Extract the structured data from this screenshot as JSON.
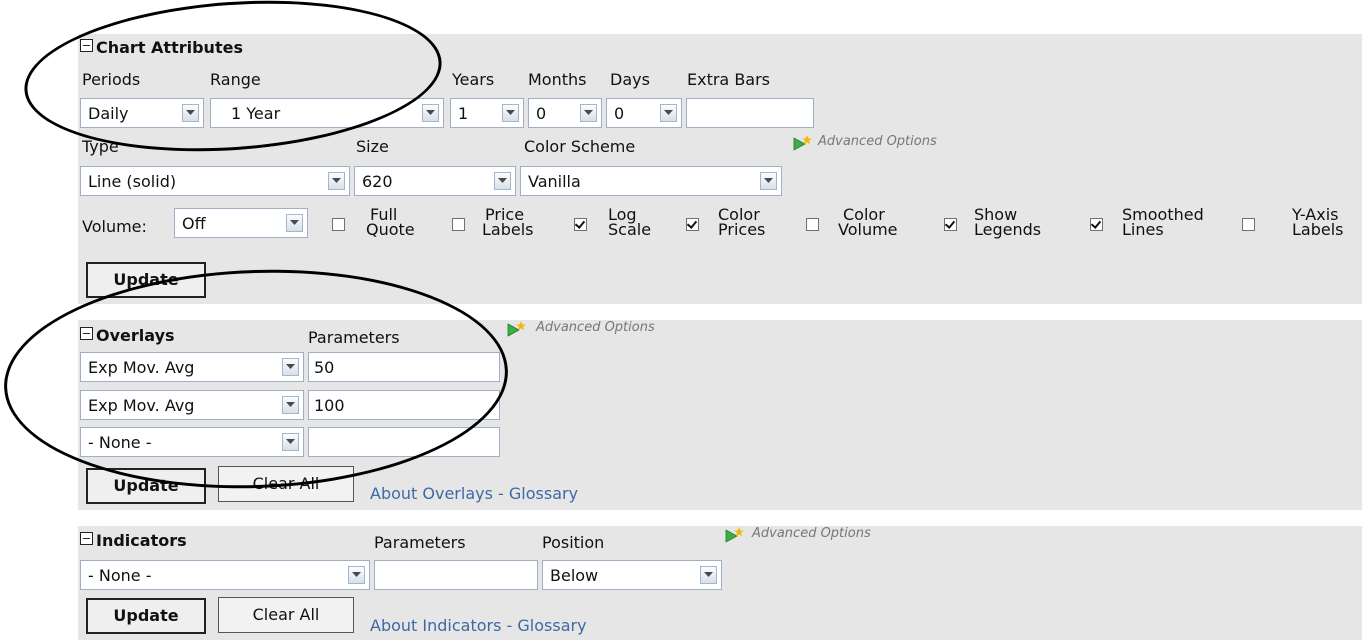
{
  "chart_attributes": {
    "title": "Chart Attributes",
    "periods_label": "Periods",
    "range_label": "Range",
    "years_label": "Years",
    "months_label": "Months",
    "days_label": "Days",
    "extra_bars_label": "Extra Bars",
    "periods_value": "Daily",
    "range_value": "1 Year",
    "years_value": "1",
    "months_value": "0",
    "days_value": "0",
    "extra_bars_value": "",
    "type_label": "Type",
    "size_label": "Size",
    "color_scheme_label": "Color Scheme",
    "advanced_options": "Advanced Options",
    "type_value": "Line (solid)",
    "size_value": "620",
    "color_scheme_value": "Vanilla",
    "volume_label": "Volume:",
    "volume_value": "Off",
    "checkboxes": [
      {
        "line1": "Full",
        "line2": "Quote",
        "checked": false
      },
      {
        "line1": "Price",
        "line2": "Labels",
        "checked": false
      },
      {
        "line1": "Log",
        "line2": "Scale",
        "checked": true
      },
      {
        "line1": "Color",
        "line2": "Prices",
        "checked": true
      },
      {
        "line1": "Color",
        "line2": "Volume",
        "checked": false
      },
      {
        "line1": "Show",
        "line2": "Legends",
        "checked": true
      },
      {
        "line1": "Smoothed",
        "line2": "Lines",
        "checked": true
      },
      {
        "line1": "Y-Axis",
        "line2": "Labels",
        "checked": false
      }
    ],
    "update_label": "Update"
  },
  "overlays": {
    "title": "Overlays",
    "parameters_label": "Parameters",
    "advanced_options": "Advanced Options",
    "rows": [
      {
        "type": "Exp Mov. Avg",
        "param": "50"
      },
      {
        "type": "Exp Mov. Avg",
        "param": "100"
      },
      {
        "type": "- None -",
        "param": ""
      }
    ],
    "update_label": "Update",
    "clear_all_label": "Clear All",
    "about_link": "About Overlays",
    "separator": " - ",
    "glossary_link": "Glossary"
  },
  "indicators": {
    "title": "Indicators",
    "parameters_label": "Parameters",
    "position_label": "Position",
    "advanced_options": "Advanced Options",
    "type_value": "- None -",
    "param_value": "",
    "position_value": "Below",
    "update_label": "Update",
    "clear_all_label": "Clear All",
    "about_link": "About Indicators",
    "separator": " - ",
    "glossary_link": "Glossary"
  },
  "colors": {
    "panel_bg": "#e6e6e6",
    "link": "#3d69a5",
    "advanced_arrow": "#3cb043",
    "advanced_star": "#f5b800"
  }
}
